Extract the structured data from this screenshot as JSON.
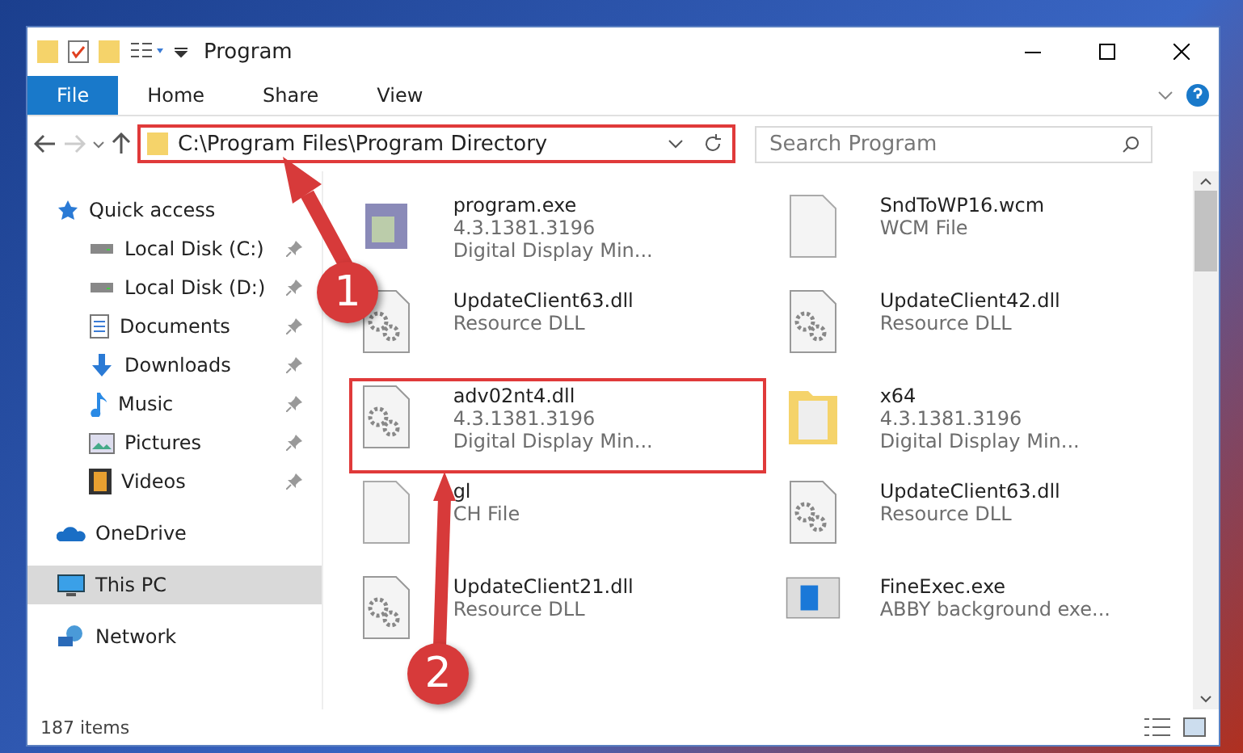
{
  "window": {
    "title": "Program"
  },
  "ribbon_tabs": [
    {
      "label": "File",
      "selected": true
    },
    {
      "label": "Home",
      "selected": false
    },
    {
      "label": "Share",
      "selected": false
    },
    {
      "label": "View",
      "selected": false
    }
  ],
  "address": {
    "path": "C:\\Program Files\\Program Directory"
  },
  "search": {
    "placeholder": "Search Program"
  },
  "sidebar": {
    "items": [
      {
        "label": "Quick access",
        "selected": false,
        "children": [
          {
            "label": "Local Disk (C:)",
            "pinned": true,
            "selected": false
          },
          {
            "label": "Local Disk (D:)",
            "pinned": true,
            "selected": false
          },
          {
            "label": "Documents",
            "pinned": true,
            "selected": false
          },
          {
            "label": "Downloads",
            "pinned": true,
            "selected": false
          },
          {
            "label": "Music",
            "pinned": true,
            "selected": false
          },
          {
            "label": "Pictures",
            "pinned": true,
            "selected": false
          },
          {
            "label": "Videos",
            "pinned": true,
            "selected": false
          }
        ]
      },
      {
        "label": "OneDrive",
        "selected": false
      },
      {
        "label": "This PC",
        "selected": true
      },
      {
        "label": "Network",
        "selected": false
      }
    ]
  },
  "files": [
    {
      "kind": "exe",
      "name": "program.exe",
      "lines": [
        "4.3.1381.3196",
        "Digital Display Min..."
      ],
      "highlighted": false
    },
    {
      "kind": "file",
      "name": "SndToWP16.wcm",
      "lines": [
        "WCM File"
      ],
      "highlighted": false
    },
    {
      "kind": "dll",
      "name": "UpdateClient63.dll",
      "lines": [
        "Resource DLL"
      ],
      "highlighted": false
    },
    {
      "kind": "dll",
      "name": "UpdateClient42.dll",
      "lines": [
        "Resource DLL"
      ],
      "highlighted": false
    },
    {
      "kind": "dll",
      "name": "adv02nt4.dll",
      "lines": [
        "4.3.1381.3196",
        "Digital Display Min..."
      ],
      "highlighted": true
    },
    {
      "kind": "folder",
      "name": "x64",
      "lines": [
        "4.3.1381.3196",
        "Digital Display Min..."
      ],
      "highlighted": false
    },
    {
      "kind": "file",
      "name": "gl",
      "lines": [
        "CH File"
      ],
      "highlighted": false
    },
    {
      "kind": "dll",
      "name": "UpdateClient63.dll",
      "lines": [
        "Resource DLL"
      ],
      "highlighted": false
    },
    {
      "kind": "dll",
      "name": "UpdateClient21.dll",
      "lines": [
        "Resource DLL"
      ],
      "highlighted": false
    },
    {
      "kind": "app",
      "name": "FineExec.exe",
      "lines": [
        "ABBY background exe..."
      ],
      "highlighted": false
    }
  ],
  "status_bar": {
    "count": "187 items"
  },
  "callouts": [
    {
      "number": "1"
    },
    {
      "number": "2"
    }
  ]
}
